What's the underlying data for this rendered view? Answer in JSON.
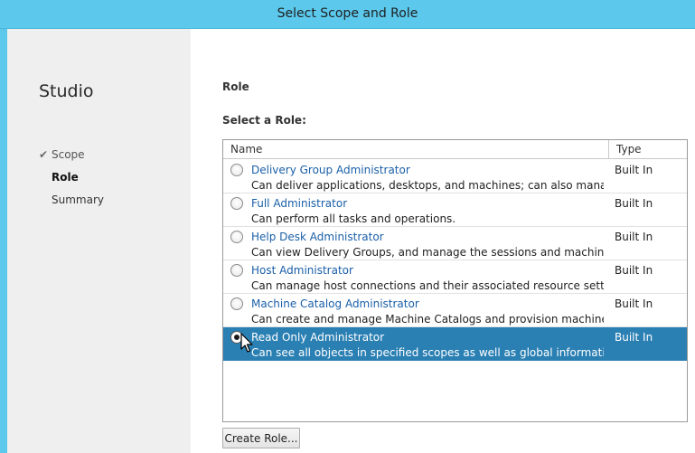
{
  "window": {
    "title": "Select Scope and Role"
  },
  "sidebar": {
    "heading": "Studio",
    "steps": [
      {
        "label": "Scope",
        "state": "done"
      },
      {
        "label": "Role",
        "state": "active"
      },
      {
        "label": "Summary",
        "state": "pending"
      }
    ]
  },
  "main": {
    "section_title": "Role",
    "select_label": "Select a Role:",
    "columns": {
      "name": "Name",
      "type": "Type"
    },
    "roles": [
      {
        "name": "Delivery Group Administrator",
        "description": "Can deliver applications, desktops, and machines; can also manage the...",
        "type": "Built In",
        "selected": false
      },
      {
        "name": "Full Administrator",
        "description": "Can perform all tasks and operations.",
        "type": "Built In",
        "selected": false
      },
      {
        "name": "Help Desk Administrator",
        "description": "Can view Delivery Groups, and manage the sessions and machines asso...",
        "type": "Built In",
        "selected": false
      },
      {
        "name": "Host Administrator",
        "description": "Can manage host connections and their associated resource settings.",
        "type": "Built In",
        "selected": false
      },
      {
        "name": "Machine Catalog Administrator",
        "description": "Can create and manage Machine Catalogs and provision machines.",
        "type": "Built In",
        "selected": false
      },
      {
        "name": "Read Only Administrator",
        "description": "Can see all objects in specified scopes as well as global information, bu...",
        "type": "Built In",
        "selected": true
      }
    ],
    "create_button": "Create Role..."
  },
  "icons": {
    "check": "checkmark-icon",
    "cursor": "mouse-pointer-icon"
  },
  "colors": {
    "titlebar": "#5bc8ec",
    "selection": "#2a7fb3",
    "link": "#1a5fa8"
  }
}
